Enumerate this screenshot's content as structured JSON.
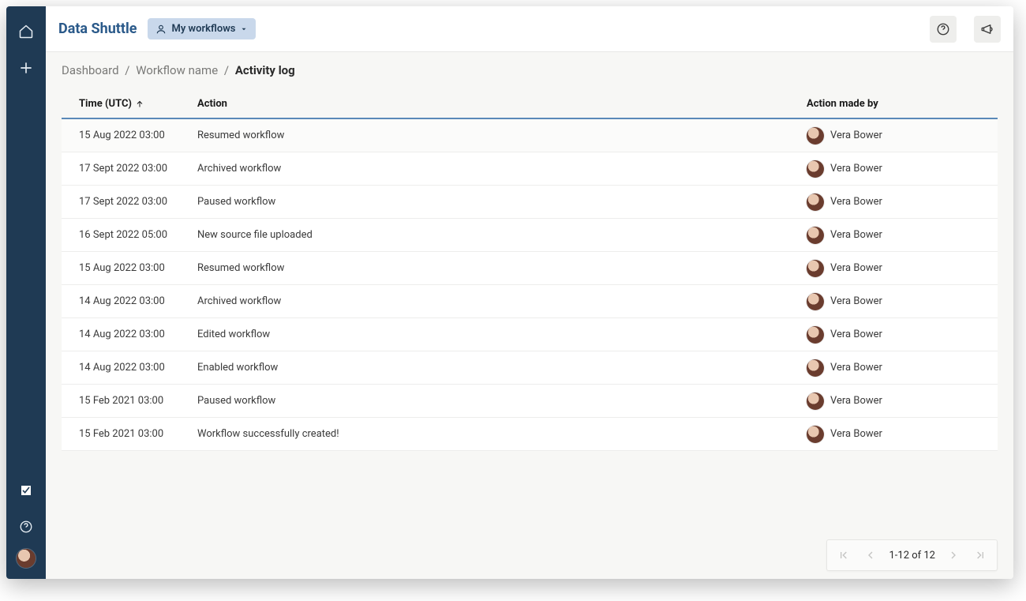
{
  "app": {
    "title": "Data Shuttle"
  },
  "header": {
    "workflows_chip": "My workflows"
  },
  "breadcrumb": {
    "dashboard": "Dashboard",
    "workflow": "Workflow name",
    "current": "Activity log"
  },
  "table": {
    "columns": {
      "time": "Time (UTC)",
      "action": "Action",
      "by": "Action made by"
    }
  },
  "rows": [
    {
      "time": "15 Aug 2022 03:00",
      "action": "Resumed workflow",
      "by": "Vera Bower"
    },
    {
      "time": "17 Sept 2022 03:00",
      "action": "Archived workflow",
      "by": "Vera Bower"
    },
    {
      "time": "17 Sept 2022 03:00",
      "action": "Paused workflow",
      "by": "Vera Bower"
    },
    {
      "time": "16 Sept 2022 05:00",
      "action": "New source file uploaded",
      "by": "Vera Bower"
    },
    {
      "time": "15 Aug 2022 03:00",
      "action": "Resumed workflow",
      "by": "Vera Bower"
    },
    {
      "time": "14 Aug 2022 03:00",
      "action": "Archived workflow",
      "by": "Vera Bower"
    },
    {
      "time": "14 Aug 2022 03:00",
      "action": "Edited workflow",
      "by": "Vera Bower"
    },
    {
      "time": "14 Aug 2022 03:00",
      "action": "Enabled workflow",
      "by": "Vera Bower"
    },
    {
      "time": "15 Feb 2021 03:00",
      "action": "Paused workflow",
      "by": "Vera Bower"
    },
    {
      "time": "15 Feb 2021 03:00",
      "action": "Workflow successfully created!",
      "by": "Vera Bower"
    }
  ],
  "pagination": {
    "label": "1-12 of 12"
  }
}
